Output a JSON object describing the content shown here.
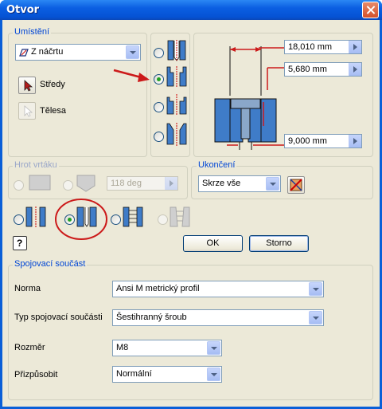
{
  "window": {
    "title": "Otvor"
  },
  "placement": {
    "group_label": "Umístění",
    "source_value": "Z náčrtu",
    "centers_label": "Středy",
    "solids_label": "Tělesa"
  },
  "dimensions": {
    "d1": "18,010 mm",
    "d2": "5,680 mm",
    "d3": "9,000 mm"
  },
  "drill_point": {
    "group_label": "Hrot vrtáku",
    "angle": "118 deg"
  },
  "termination": {
    "group_label": "Ukončení",
    "value": "Skrze vše"
  },
  "buttons": {
    "ok": "OK",
    "cancel": "Storno",
    "help": "?"
  },
  "fastener": {
    "group_label": "Spojovací součást",
    "standard_label": "Norma",
    "standard_value": "Ansi M metrický profil",
    "type_label": "Typ spojovací součásti",
    "type_value": "Šestihranný šroub",
    "size_label": "Rozměr",
    "size_value": "M8",
    "fit_label": "Přizpůsobit",
    "fit_value": "Normální"
  },
  "colors": {
    "accent": "#0046d5",
    "annotation": "#cc1a1a"
  }
}
